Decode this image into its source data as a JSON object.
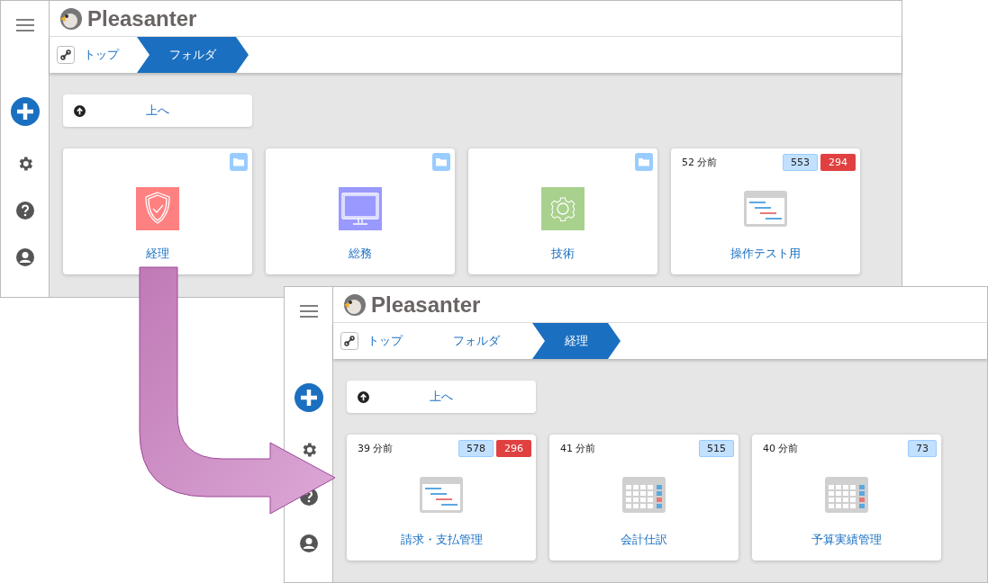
{
  "windows": [
    {
      "logo": "Pleasanter",
      "breadcrumb": [
        {
          "label": "トップ",
          "selected": false
        },
        {
          "label": "フォルダ",
          "selected": true
        }
      ],
      "up_button": "上へ",
      "cards": [
        {
          "kind": "folder",
          "image": {
            "kind": "shield"
          },
          "title": "経理"
        },
        {
          "kind": "folder",
          "image": {
            "kind": "monitor"
          },
          "title": "総務"
        },
        {
          "kind": "folder",
          "image": {
            "kind": "gear"
          },
          "title": "技術"
        },
        {
          "kind": "site",
          "image": {
            "kind": "gantt"
          },
          "time": "52 分前",
          "badges": [
            {
              "text": "553",
              "kind": "info"
            },
            {
              "text": "294",
              "kind": "alert"
            }
          ],
          "title": "操作テスト用"
        }
      ]
    },
    {
      "logo": "Pleasanter",
      "breadcrumb": [
        {
          "label": "トップ",
          "selected": false
        },
        {
          "label": "フォルダ",
          "selected": false
        },
        {
          "label": "経理",
          "selected": true
        }
      ],
      "up_button": "上へ",
      "cards": [
        {
          "kind": "site",
          "image": {
            "kind": "gantt"
          },
          "time": "39 分前",
          "badges": [
            {
              "text": "578",
              "kind": "info"
            },
            {
              "text": "296",
              "kind": "alert"
            }
          ],
          "title": "請求・支払管理"
        },
        {
          "kind": "site",
          "image": {
            "kind": "grid"
          },
          "time": "41 分前",
          "badges": [
            {
              "text": "515",
              "kind": "info"
            }
          ],
          "title": "会計仕訳"
        },
        {
          "kind": "site",
          "image": {
            "kind": "grid"
          },
          "time": "40 分前",
          "badges": [
            {
              "text": "73",
              "kind": "info"
            }
          ],
          "title": "予算実績管理"
        }
      ]
    }
  ]
}
